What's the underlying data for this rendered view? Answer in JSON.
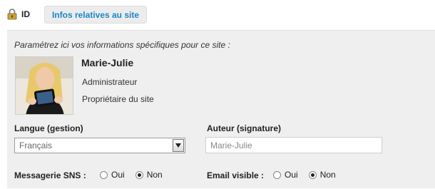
{
  "tabs": {
    "id_label": "ID",
    "site_label": "Infos relatives au site"
  },
  "panel": {
    "intro": "Paramétrez ici vos informations spécifiques pour ce site :"
  },
  "profile": {
    "name": "Marie-Julie",
    "role": "Administrateur",
    "owner": "Propriétaire du site"
  },
  "form": {
    "language_label": "Langue (gestion)",
    "language_value": "Français",
    "author_label": "Auteur (signature)",
    "author_value": "Marie-Julie",
    "sns_label": "Messagerie SNS :",
    "sns_options": [
      {
        "label": "Oui",
        "checked": false
      },
      {
        "label": "Non",
        "checked": true
      }
    ],
    "email_label": "Email visible :",
    "email_options": [
      {
        "label": "Oui",
        "checked": false
      },
      {
        "label": "Non",
        "checked": true
      }
    ]
  },
  "icons": {
    "lock": "lock-icon",
    "dropdown": "chevron-down-icon",
    "avatar": "profile-photo"
  },
  "colors": {
    "tab_text": "#1a86c8",
    "panel_bg": "#efefef"
  }
}
